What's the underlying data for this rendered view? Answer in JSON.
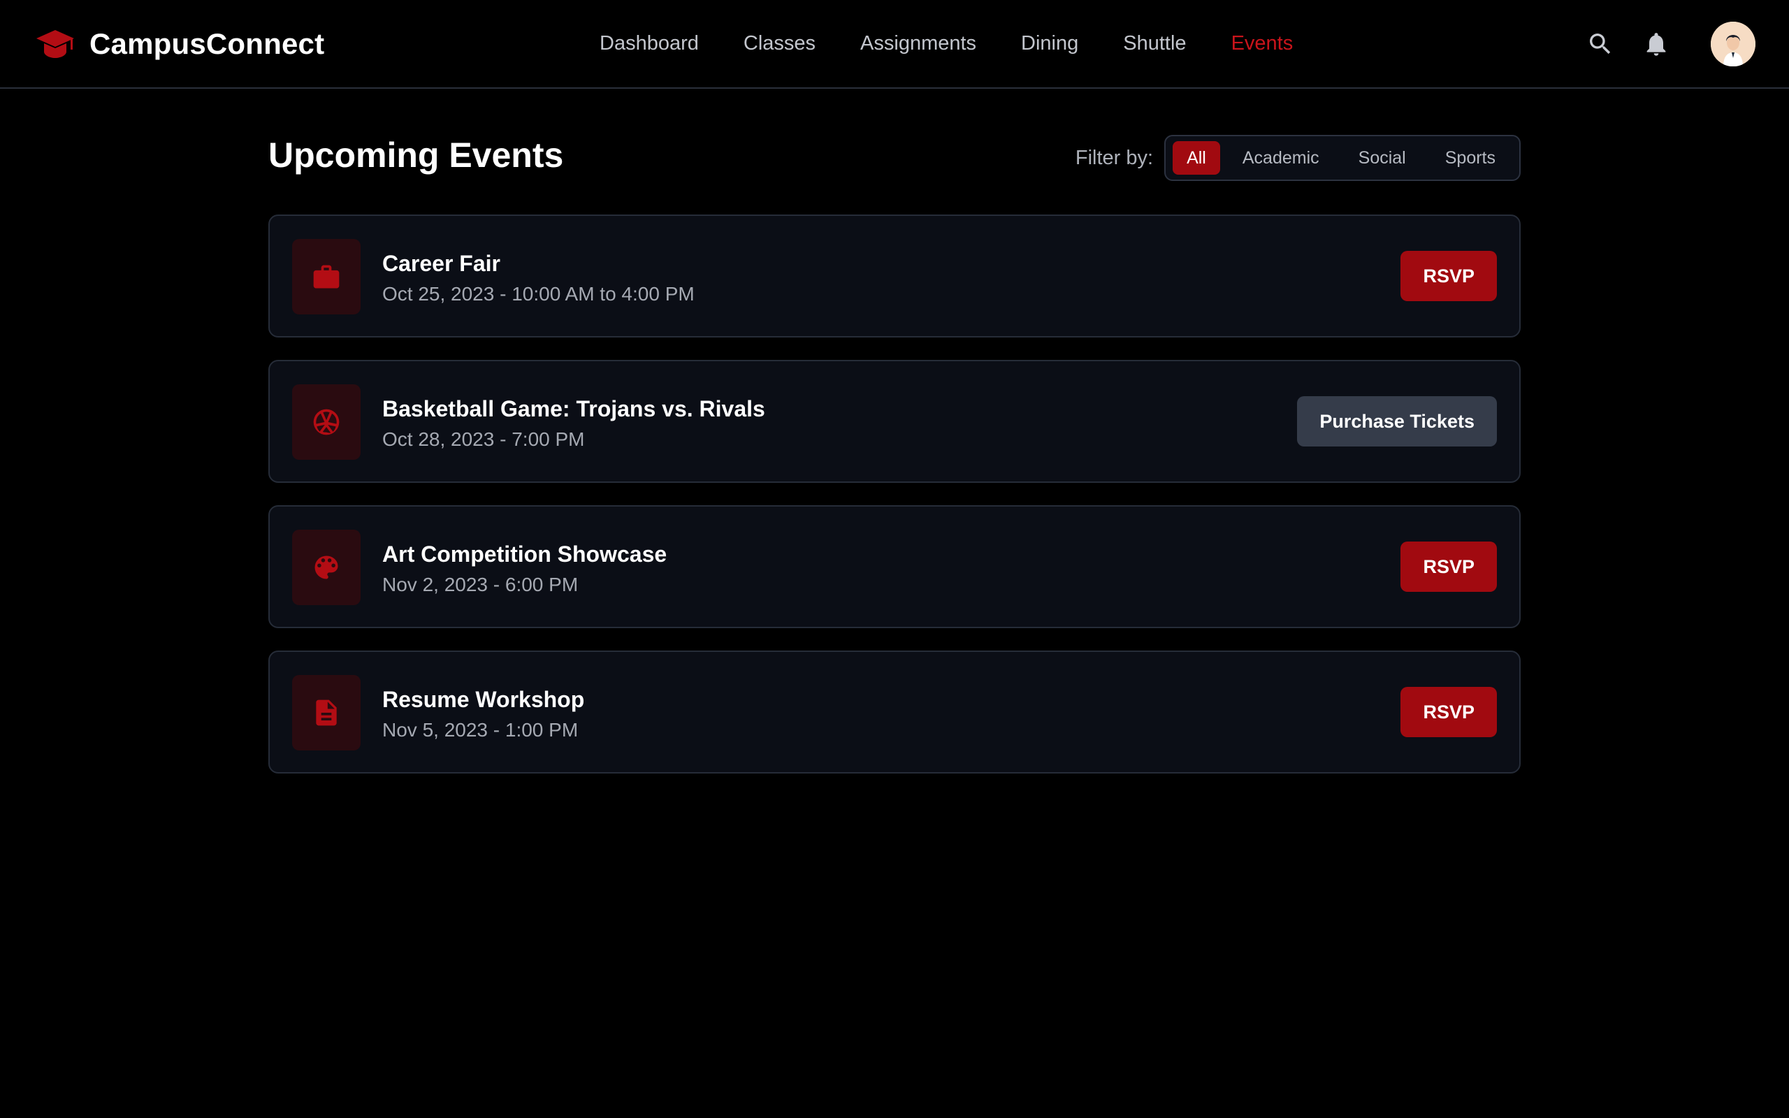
{
  "app": {
    "name": "CampusConnect",
    "logo_icon": "graduation-cap-icon",
    "accent_color": "#c8141b"
  },
  "nav": {
    "items": [
      {
        "label": "Dashboard",
        "active": false
      },
      {
        "label": "Classes",
        "active": false
      },
      {
        "label": "Assignments",
        "active": false
      },
      {
        "label": "Dining",
        "active": false
      },
      {
        "label": "Shuttle",
        "active": false
      },
      {
        "label": "Events",
        "active": true
      }
    ]
  },
  "header_actions": {
    "search_icon": "search-icon",
    "notification_icon": "bell-icon",
    "avatar": "user-avatar"
  },
  "page": {
    "title": "Upcoming Events",
    "filter_label": "Filter by:",
    "filters": [
      {
        "label": "All",
        "active": true
      },
      {
        "label": "Academic",
        "active": false
      },
      {
        "label": "Social",
        "active": false
      },
      {
        "label": "Sports",
        "active": false
      }
    ]
  },
  "events": [
    {
      "title": "Career Fair",
      "date": "Oct 25, 2023 - 10:00 AM to 4:00 PM",
      "icon": "briefcase-icon",
      "action": "RSVP",
      "action_style": "primary"
    },
    {
      "title": "Basketball Game: Trojans vs. Rivals",
      "date": "Oct 28, 2023 - 7:00 PM",
      "icon": "basketball-icon",
      "action": "Purchase Tickets",
      "action_style": "secondary"
    },
    {
      "title": "Art Competition Showcase",
      "date": "Nov 2, 2023 - 6:00 PM",
      "icon": "palette-icon",
      "action": "RSVP",
      "action_style": "primary"
    },
    {
      "title": "Resume Workshop",
      "date": "Nov 5, 2023 - 1:00 PM",
      "icon": "document-icon",
      "action": "RSVP",
      "action_style": "primary"
    }
  ]
}
